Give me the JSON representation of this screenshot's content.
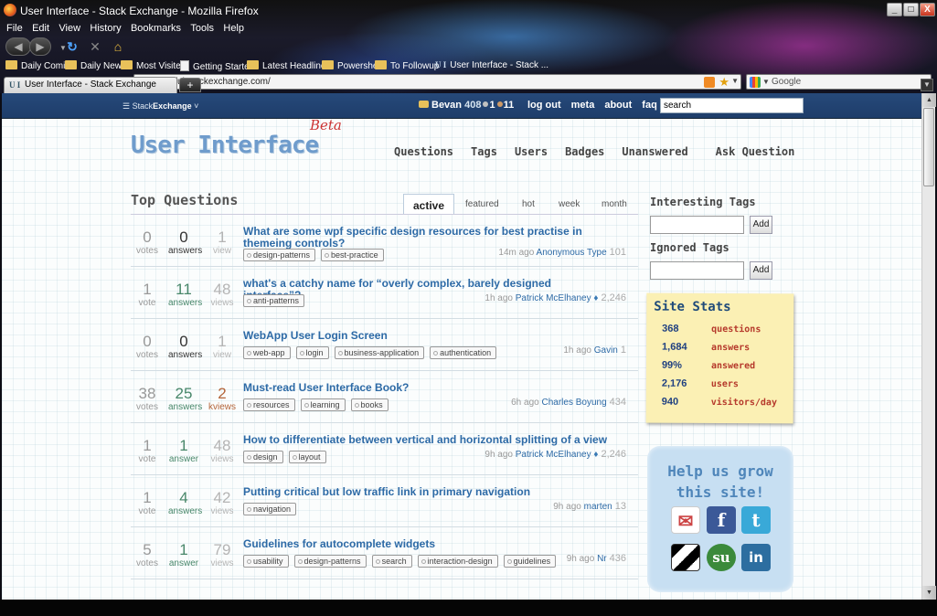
{
  "browser": {
    "title": "User Interface - Stack Exchange - Mozilla Firefox",
    "window_buttons": {
      "min": "_",
      "max": "□",
      "close": "X"
    },
    "menu": [
      "File",
      "Edit",
      "View",
      "History",
      "Bookmarks",
      "Tools",
      "Help"
    ],
    "url": "http://ui.stackexchange.com/",
    "url_favicon": "U I",
    "search_placeholder": "Google",
    "bookmarks": [
      "Daily Comics",
      "Daily News",
      "Most Visited",
      "Getting Started",
      "Latest Headlines",
      "Powershell",
      "To Followup",
      "User Interface - Stack ..."
    ],
    "tab": {
      "label": "User Interface - Stack Exchange",
      "new": "+"
    }
  },
  "sebar": {
    "brand_prefix": "Stack",
    "brand_suffix": "Exchange",
    "user": "Bevan",
    "rep": "408",
    "silver": "1",
    "bronze": "11",
    "links": [
      "log out",
      "meta",
      "about",
      "faq"
    ],
    "search_value": "search"
  },
  "site": {
    "logo": "User Interface",
    "beta": "Beta",
    "nav": [
      "Questions",
      "Tags",
      "Users",
      "Badges",
      "Unanswered"
    ],
    "ask": "Ask Question"
  },
  "main": {
    "heading": "Top Questions",
    "tabs": [
      "active",
      "featured",
      "hot",
      "week",
      "month"
    ],
    "questions": [
      {
        "votes": "0",
        "votes_l": "votes",
        "answers": "0",
        "answers_l": "answers",
        "views": "1",
        "views_l": "view",
        "title": "What are some wpf specific design resources for best practise in themeing controls?",
        "tags": [
          "design-patterns",
          "best-practice"
        ],
        "time": "14m ago",
        "user": "Anonymous Type",
        "rep": "101"
      },
      {
        "votes": "1",
        "votes_l": "vote",
        "answers": "11",
        "answers_l": "answers",
        "views": "48",
        "views_l": "views",
        "title": "what's a catchy name for “overly complex, barely designed interface”?",
        "tags": [
          "anti-patterns"
        ],
        "time": "1h ago",
        "user": "Patrick McElhaney",
        "mod": "♦",
        "rep": "2,246"
      },
      {
        "votes": "0",
        "votes_l": "votes",
        "answers": "0",
        "answers_l": "answers",
        "views": "1",
        "views_l": "view",
        "title": "WebApp User Login Screen",
        "tags": [
          "web-app",
          "login",
          "business-application",
          "authentication"
        ],
        "time": "1h ago",
        "user": "Gavin",
        "rep": "1"
      },
      {
        "votes": "38",
        "votes_l": "votes",
        "answers": "25",
        "answers_l": "answers",
        "views": "2",
        "views_l": "kviews",
        "title": "Must-read User Interface Book?",
        "tags": [
          "resources",
          "learning",
          "books"
        ],
        "time": "6h ago",
        "user": "Charles Boyung",
        "rep": "434"
      },
      {
        "votes": "1",
        "votes_l": "vote",
        "answers": "1",
        "answers_l": "answer",
        "views": "48",
        "views_l": "views",
        "title": "How to differentiate between vertical and horizontal splitting of a view",
        "tags": [
          "design",
          "layout"
        ],
        "time": "9h ago",
        "user": "Patrick McElhaney",
        "mod": "♦",
        "rep": "2,246"
      },
      {
        "votes": "1",
        "votes_l": "vote",
        "answers": "4",
        "answers_l": "answers",
        "views": "42",
        "views_l": "views",
        "title": "Putting critical but low traffic link in primary navigation",
        "tags": [
          "navigation"
        ],
        "time": "9h ago",
        "user": "marten",
        "rep": "13"
      },
      {
        "votes": "5",
        "votes_l": "votes",
        "answers": "1",
        "answers_l": "answer",
        "views": "79",
        "views_l": "views",
        "title": "Guidelines for autocomplete widgets",
        "tags": [
          "usability",
          "design-patterns",
          "search",
          "interaction-design",
          "guidelines"
        ],
        "time": "9h ago",
        "user": "Nr",
        "rep": "436"
      }
    ]
  },
  "side": {
    "interesting": "Interesting Tags",
    "ignored": "Ignored Tags",
    "add": "Add",
    "stats_title": "Site Stats",
    "stats": [
      {
        "v": "368",
        "k": "questions"
      },
      {
        "v": "1,684",
        "k": "answers"
      },
      {
        "v": "99%",
        "k": "answered"
      },
      {
        "v": "2,176",
        "k": "users"
      },
      {
        "v": "940",
        "k": "visitors/day"
      }
    ],
    "help_line1": "Help us grow",
    "help_line2": "this site!"
  }
}
